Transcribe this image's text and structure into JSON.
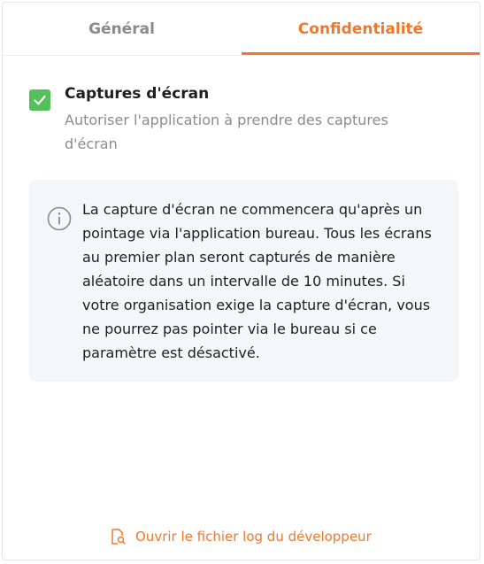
{
  "tabs": [
    {
      "label": "Général",
      "active": false
    },
    {
      "label": "Confidentialité",
      "active": true
    }
  ],
  "accent_color": "#f0782b",
  "screenshot_setting": {
    "checked": true,
    "checkbox_color": "#54c05c",
    "title": "Captures d'écran",
    "description": "Autoriser l'application à prendre des captures d'écran"
  },
  "info": {
    "icon": "info-icon",
    "text": "La capture d'écran ne commencera qu'après un pointage via l'application bureau. Tous les écrans au premier plan seront capturés de manière aléatoire dans un intervalle de 10 minutes. Si votre organisation exige la capture d'écran, vous ne pourrez pas pointer via le bureau si ce paramètre est désactivé."
  },
  "footer": {
    "icon": "file-search-icon",
    "link_label": "Ouvrir le fichier log du développeur"
  }
}
